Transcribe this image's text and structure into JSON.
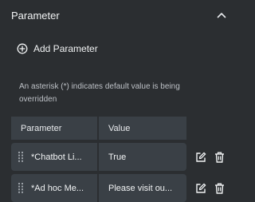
{
  "section": {
    "title": "Parameter"
  },
  "add_parameter": {
    "label": "Add Parameter"
  },
  "note": {
    "text": "An asterisk (*) indicates default value is being overridden"
  },
  "table": {
    "headers": [
      "Parameter",
      "Value"
    ],
    "rows": [
      {
        "parameter": "*Chatbot Li...",
        "value": "True"
      },
      {
        "parameter": "*Ad hoc Me...",
        "value": "Please visit ou..."
      }
    ]
  },
  "icons": {
    "collapse": "chevron-up-icon",
    "add": "plus-circle-icon",
    "drag": "drag-handle-icon",
    "edit": "edit-icon",
    "delete": "trash-icon"
  },
  "colors": {
    "background": "#2b2e31",
    "cell": "#3a4046",
    "text": "#f1f3f4",
    "muted_text": "#bdc1c6"
  }
}
